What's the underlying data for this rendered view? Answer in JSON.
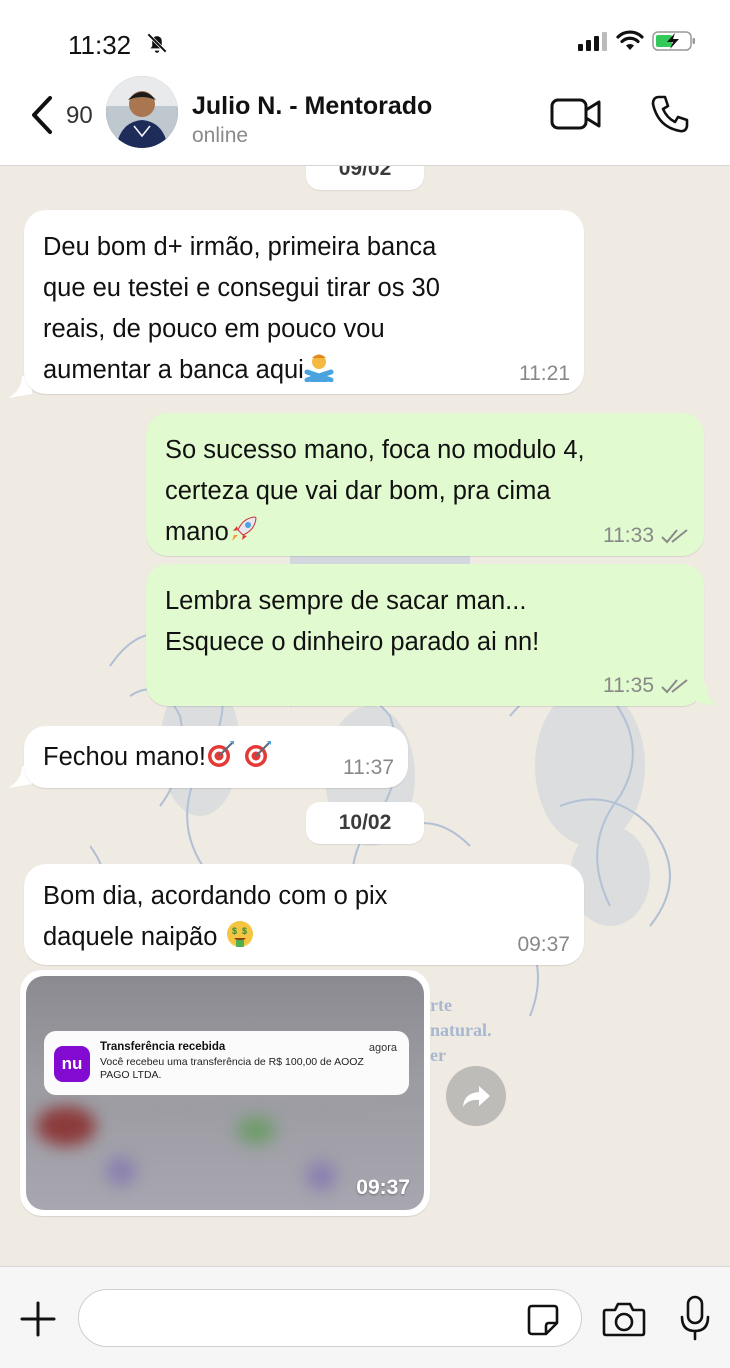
{
  "status_bar": {
    "time": "11:32"
  },
  "header": {
    "back_count": "90",
    "contact_name": "Julio N. - Mentorado",
    "contact_status": "online"
  },
  "chat": {
    "dates": [
      "09/02",
      "10/02"
    ],
    "messages": [
      {
        "direction": "in",
        "text": "Deu bom d+ irmão, primeira banca\nque eu testei e consegui tirar os 30\nreais, de pouco em pouco vou\naumentar a banca aqui",
        "time": "11:21"
      },
      {
        "direction": "out",
        "text": "So sucesso mano, foca no modulo 4,\ncerteza que vai dar bom, pra cima\nmano",
        "time": "11:33"
      },
      {
        "direction": "out",
        "text": "Lembra sempre de sacar man...\nEsquece o dinheiro parado ai nn!",
        "time": "11:35"
      },
      {
        "direction": "in",
        "text": "Fechou mano!",
        "time": "11:37"
      },
      {
        "direction": "in",
        "text": "Bom dia, acordando com o pix\ndaquele naipão",
        "time": "09:37"
      }
    ],
    "image_message": {
      "time": "09:37",
      "notification": {
        "app_logo_text": "nu",
        "title": "Transferência recebida",
        "time": "agora",
        "body": "Você recebeu uma transferência de R$ 100,00 de AOOZ PAGO LTDA."
      }
    },
    "background_text": [
      "rte",
      "natural.",
      "er"
    ]
  },
  "input_bar": {
    "placeholder": ""
  },
  "colors": {
    "incoming_bubble": "#ffffff",
    "outgoing_bubble": "#e1fad0",
    "chat_background": "#efeae2",
    "nubank_purple": "#820ad1"
  },
  "icons": [
    "bell-off-icon",
    "signal-icon",
    "wifi-icon",
    "battery-charging-icon",
    "back-chevron-icon",
    "video-camera-icon",
    "phone-icon",
    "double-check-icon",
    "share-forward-icon",
    "plus-icon",
    "sticker-icon",
    "camera-icon",
    "microphone-icon"
  ]
}
